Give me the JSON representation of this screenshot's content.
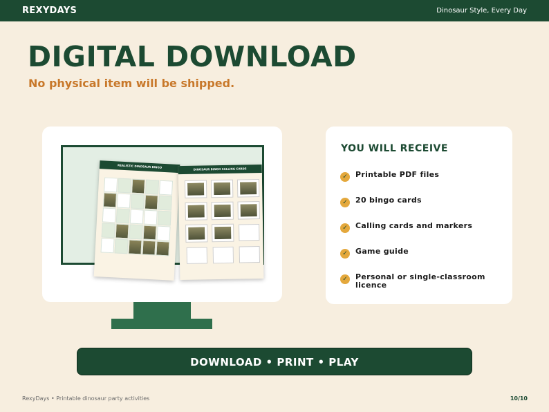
{
  "header": {
    "brand": "REXYDAYS",
    "tagline": "Dinosaur Style, Every Day"
  },
  "hero": {
    "title": "DIGITAL DOWNLOAD",
    "subtitle": "No physical item will be shipped."
  },
  "preview": {
    "sheet1_title": "REALISTIC DINOSAUR BINGO",
    "sheet2_title": "DINOSAUR BINGO CALLING CARDS"
  },
  "receive": {
    "title": "YOU WILL RECEIVE",
    "items": [
      "Printable PDF files",
      "20 bingo cards",
      "Calling cards and markers",
      "Game guide",
      "Personal or single-classroom licence"
    ],
    "check_icon": "✓"
  },
  "cta": {
    "label": "DOWNLOAD • PRINT • PLAY"
  },
  "footer": {
    "left": "RexyDays • Printable dinosaur party activities",
    "page": "10/10"
  },
  "colors": {
    "brand_green": "#1c4a32",
    "accent_orange": "#c8782a",
    "check_gold": "#e4a83c",
    "background": "#f7eedf"
  }
}
